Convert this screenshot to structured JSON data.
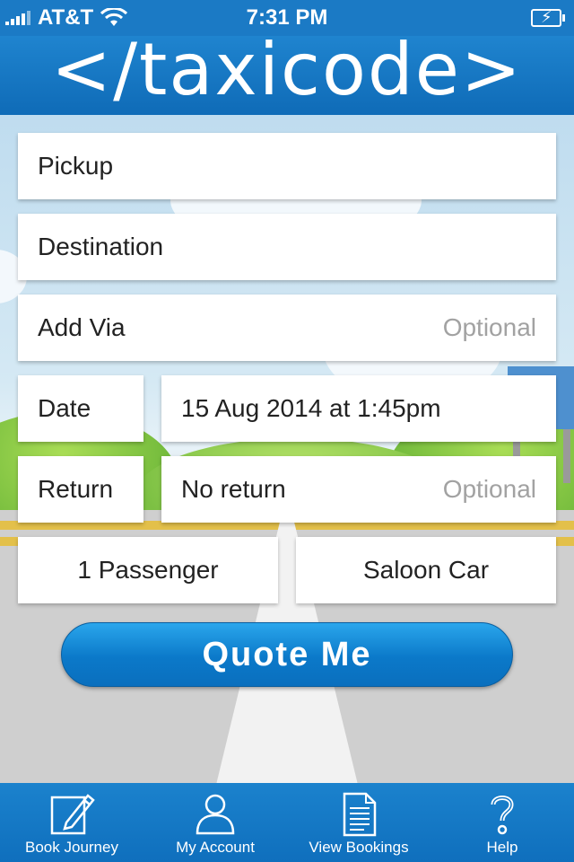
{
  "status_bar": {
    "carrier": "AT&T",
    "time": "7:31 PM"
  },
  "header": {
    "title": "</taxicode>"
  },
  "form": {
    "pickup": {
      "label": "Pickup"
    },
    "destination": {
      "label": "Destination"
    },
    "via": {
      "label": "Add Via",
      "placeholder": "Optional"
    },
    "date": {
      "label": "Date",
      "value": "15 Aug 2014 at 1:45pm"
    },
    "return": {
      "label": "Return",
      "value": "No return",
      "placeholder": "Optional"
    },
    "passengers": {
      "value": "1 Passenger"
    },
    "vehicle": {
      "value": "Saloon Car"
    },
    "quote_label": "Quote Me"
  },
  "tabbar": {
    "items": [
      {
        "label": "Book Journey",
        "icon": "pencil-icon"
      },
      {
        "label": "My Account",
        "icon": "person-icon"
      },
      {
        "label": "View Bookings",
        "icon": "document-icon"
      },
      {
        "label": "Help",
        "icon": "question-icon"
      }
    ]
  },
  "colors": {
    "accent": "#1b7ac5",
    "button": "#0b79c9",
    "placeholder": "#a2a2a2"
  }
}
